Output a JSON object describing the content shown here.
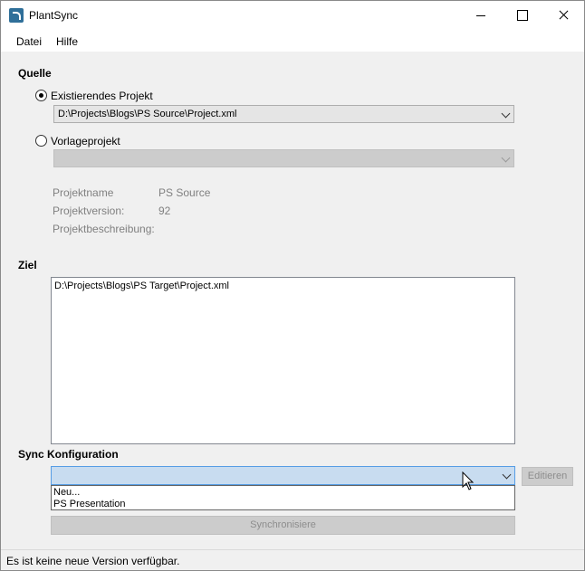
{
  "window": {
    "title": "PlantSync"
  },
  "menu": [
    "Datei",
    "Hilfe"
  ],
  "source": {
    "heading": "Quelle",
    "existing_label": "Existierendes Projekt",
    "existing_value": "D:\\Projects\\Blogs\\PS Source\\Project.xml",
    "template_label": "Vorlageprojekt",
    "template_value": "",
    "info": [
      {
        "label": "Projektname",
        "value": "PS Source"
      },
      {
        "label": "Projektversion:",
        "value": "92"
      },
      {
        "label": "Projektbeschreibung:",
        "value": ""
      }
    ]
  },
  "target": {
    "heading": "Ziel",
    "items": [
      "D:\\Projects\\Blogs\\PS Target\\Project.xml"
    ]
  },
  "sync": {
    "heading": "Sync Konfiguration",
    "selected": "",
    "options": [
      "Neu...",
      "PS Presentation"
    ],
    "edit_label": "Editieren",
    "sync_label": "Synchronisiere"
  },
  "status": {
    "text": "Es ist keine neue Version verfügbar."
  }
}
